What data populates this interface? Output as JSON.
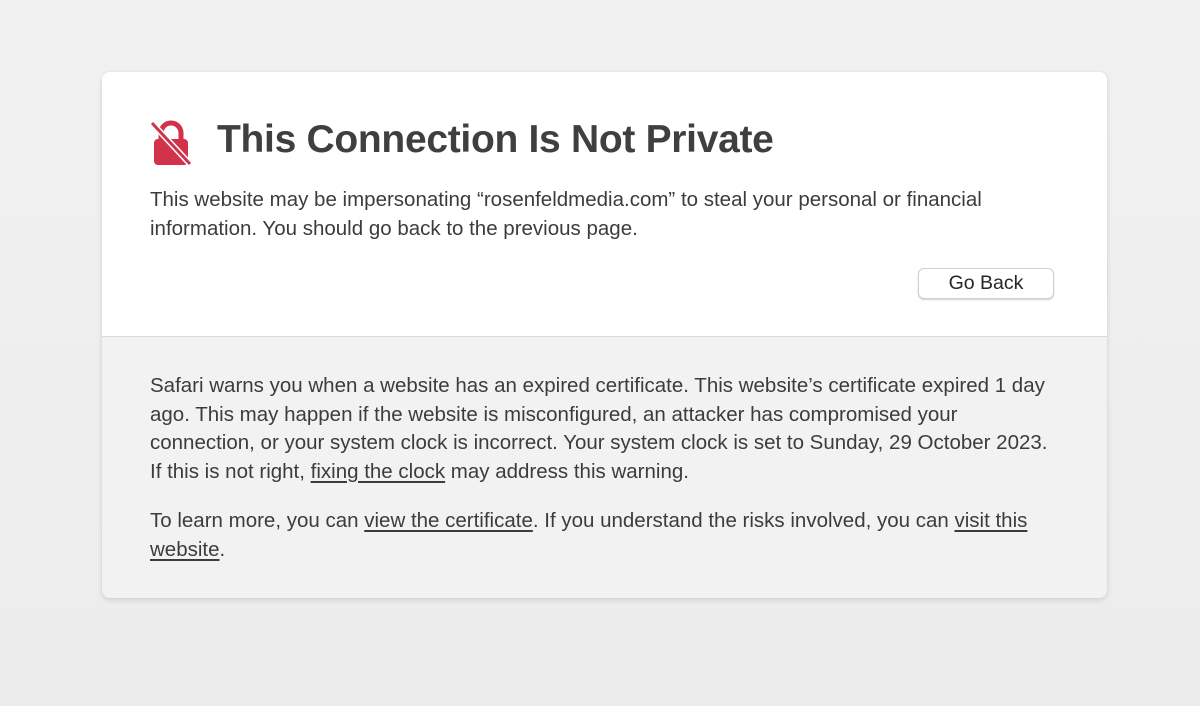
{
  "warning": {
    "title": "This Connection Is Not Private",
    "icon": "broken-lock-icon",
    "icon_color": "#d0334a",
    "description": "This website may be impersonating “rosenfeldmedia.com” to steal your personal or financial information. You should go back to the previous page.",
    "go_back_label": "Go Back"
  },
  "details": {
    "paragraph1_text": "Safari warns you when a website has an expired certificate. This website’s certificate expired 1 day ago. This may happen if the website is misconfigured, an attacker has compromised your connection, or your system clock is incorrect. Your system clock is set to Sunday, 29 October 2023. If this is not right, ",
    "paragraph1_link": "fixing the clock",
    "paragraph1_end": " may address this warning.",
    "paragraph2_start": "To learn more, you can ",
    "paragraph2_link1": "view the certificate",
    "paragraph2_mid": ". If you understand the risks involved, you can ",
    "paragraph2_link2": "visit this website",
    "paragraph2_end": "."
  }
}
